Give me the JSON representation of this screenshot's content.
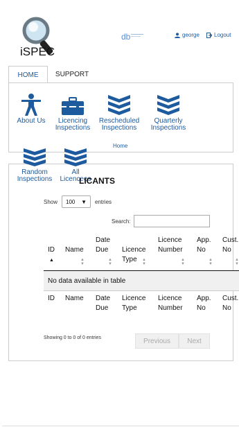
{
  "header": {
    "app_name": "iSPEC",
    "username": "george",
    "logout_label": "Logout"
  },
  "tabs": [
    {
      "label": "HOME"
    },
    {
      "label": "SUPPORT"
    }
  ],
  "menu": {
    "items": [
      {
        "label_1": "About Us",
        "label_2": ""
      },
      {
        "label_1": "Licencing",
        "label_2": "Inspections"
      },
      {
        "label_1": "Rescheduled",
        "label_2": "Inspections"
      },
      {
        "label_1": "Quarterly",
        "label_2": "Inspections"
      },
      {
        "label_1": "Random",
        "label_2": "Inspections"
      },
      {
        "label_1": "All",
        "label_2": "Licencees"
      }
    ],
    "home_link": "Home"
  },
  "applicants": {
    "title_visible": "LICANTS",
    "show_label": "Show",
    "entries_label": "entries",
    "page_size": "100",
    "search_label": "Search:",
    "columns": [
      {
        "l1": "ID",
        "l2": ""
      },
      {
        "l1": "Name",
        "l2": ""
      },
      {
        "l1": "Date",
        "l2": "Due"
      },
      {
        "l1": "Licence",
        "l2": "Type"
      },
      {
        "l1": "Licence",
        "l2": "Number"
      },
      {
        "l1": "App.",
        "l2": "No"
      },
      {
        "l1": "Cust.",
        "l2": "No"
      }
    ],
    "empty_message": "No data available in table",
    "info": "Showing 0 to 0 of 0 entries",
    "prev_label": "Previous",
    "next_label": "Next"
  },
  "colors": {
    "accent": "#1d5a9e"
  }
}
